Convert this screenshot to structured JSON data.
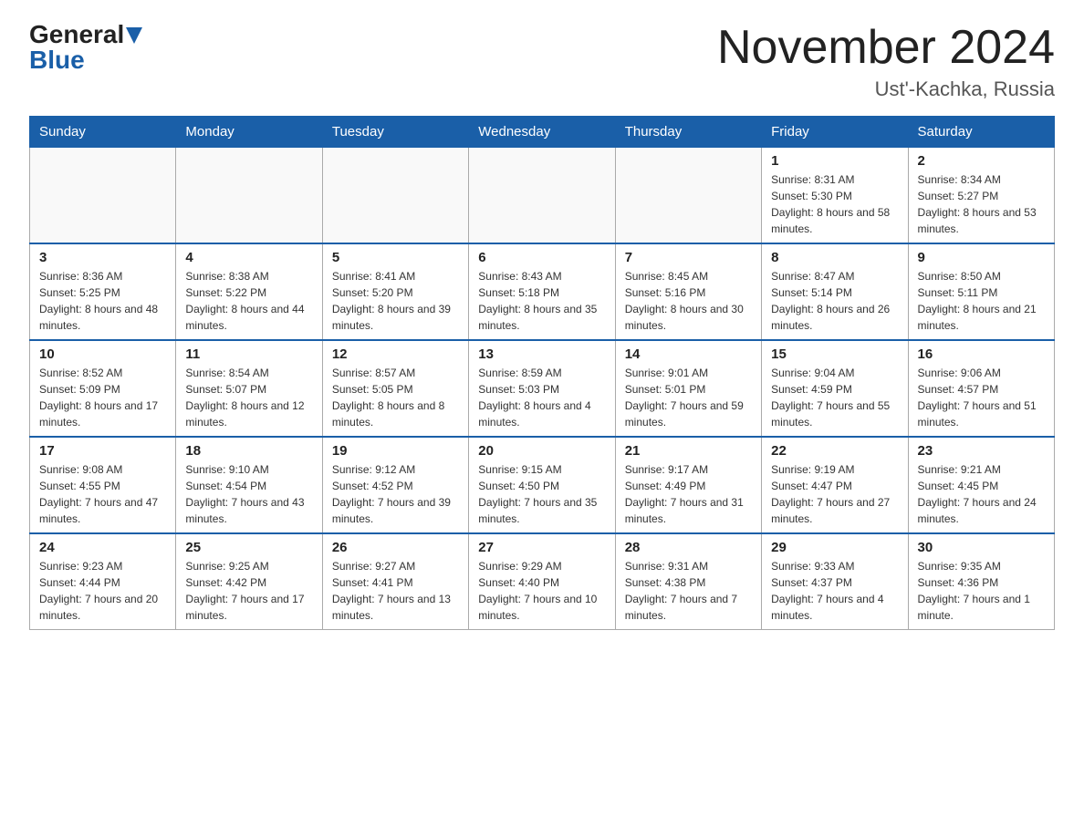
{
  "header": {
    "logo_general": "General",
    "logo_blue": "Blue",
    "month_title": "November 2024",
    "location": "Ust'-Kachka, Russia"
  },
  "days_of_week": [
    "Sunday",
    "Monday",
    "Tuesday",
    "Wednesday",
    "Thursday",
    "Friday",
    "Saturday"
  ],
  "weeks": [
    [
      {
        "day": "",
        "info": ""
      },
      {
        "day": "",
        "info": ""
      },
      {
        "day": "",
        "info": ""
      },
      {
        "day": "",
        "info": ""
      },
      {
        "day": "",
        "info": ""
      },
      {
        "day": "1",
        "info": "Sunrise: 8:31 AM\nSunset: 5:30 PM\nDaylight: 8 hours and 58 minutes."
      },
      {
        "day": "2",
        "info": "Sunrise: 8:34 AM\nSunset: 5:27 PM\nDaylight: 8 hours and 53 minutes."
      }
    ],
    [
      {
        "day": "3",
        "info": "Sunrise: 8:36 AM\nSunset: 5:25 PM\nDaylight: 8 hours and 48 minutes."
      },
      {
        "day": "4",
        "info": "Sunrise: 8:38 AM\nSunset: 5:22 PM\nDaylight: 8 hours and 44 minutes."
      },
      {
        "day": "5",
        "info": "Sunrise: 8:41 AM\nSunset: 5:20 PM\nDaylight: 8 hours and 39 minutes."
      },
      {
        "day": "6",
        "info": "Sunrise: 8:43 AM\nSunset: 5:18 PM\nDaylight: 8 hours and 35 minutes."
      },
      {
        "day": "7",
        "info": "Sunrise: 8:45 AM\nSunset: 5:16 PM\nDaylight: 8 hours and 30 minutes."
      },
      {
        "day": "8",
        "info": "Sunrise: 8:47 AM\nSunset: 5:14 PM\nDaylight: 8 hours and 26 minutes."
      },
      {
        "day": "9",
        "info": "Sunrise: 8:50 AM\nSunset: 5:11 PM\nDaylight: 8 hours and 21 minutes."
      }
    ],
    [
      {
        "day": "10",
        "info": "Sunrise: 8:52 AM\nSunset: 5:09 PM\nDaylight: 8 hours and 17 minutes."
      },
      {
        "day": "11",
        "info": "Sunrise: 8:54 AM\nSunset: 5:07 PM\nDaylight: 8 hours and 12 minutes."
      },
      {
        "day": "12",
        "info": "Sunrise: 8:57 AM\nSunset: 5:05 PM\nDaylight: 8 hours and 8 minutes."
      },
      {
        "day": "13",
        "info": "Sunrise: 8:59 AM\nSunset: 5:03 PM\nDaylight: 8 hours and 4 minutes."
      },
      {
        "day": "14",
        "info": "Sunrise: 9:01 AM\nSunset: 5:01 PM\nDaylight: 7 hours and 59 minutes."
      },
      {
        "day": "15",
        "info": "Sunrise: 9:04 AM\nSunset: 4:59 PM\nDaylight: 7 hours and 55 minutes."
      },
      {
        "day": "16",
        "info": "Sunrise: 9:06 AM\nSunset: 4:57 PM\nDaylight: 7 hours and 51 minutes."
      }
    ],
    [
      {
        "day": "17",
        "info": "Sunrise: 9:08 AM\nSunset: 4:55 PM\nDaylight: 7 hours and 47 minutes."
      },
      {
        "day": "18",
        "info": "Sunrise: 9:10 AM\nSunset: 4:54 PM\nDaylight: 7 hours and 43 minutes."
      },
      {
        "day": "19",
        "info": "Sunrise: 9:12 AM\nSunset: 4:52 PM\nDaylight: 7 hours and 39 minutes."
      },
      {
        "day": "20",
        "info": "Sunrise: 9:15 AM\nSunset: 4:50 PM\nDaylight: 7 hours and 35 minutes."
      },
      {
        "day": "21",
        "info": "Sunrise: 9:17 AM\nSunset: 4:49 PM\nDaylight: 7 hours and 31 minutes."
      },
      {
        "day": "22",
        "info": "Sunrise: 9:19 AM\nSunset: 4:47 PM\nDaylight: 7 hours and 27 minutes."
      },
      {
        "day": "23",
        "info": "Sunrise: 9:21 AM\nSunset: 4:45 PM\nDaylight: 7 hours and 24 minutes."
      }
    ],
    [
      {
        "day": "24",
        "info": "Sunrise: 9:23 AM\nSunset: 4:44 PM\nDaylight: 7 hours and 20 minutes."
      },
      {
        "day": "25",
        "info": "Sunrise: 9:25 AM\nSunset: 4:42 PM\nDaylight: 7 hours and 17 minutes."
      },
      {
        "day": "26",
        "info": "Sunrise: 9:27 AM\nSunset: 4:41 PM\nDaylight: 7 hours and 13 minutes."
      },
      {
        "day": "27",
        "info": "Sunrise: 9:29 AM\nSunset: 4:40 PM\nDaylight: 7 hours and 10 minutes."
      },
      {
        "day": "28",
        "info": "Sunrise: 9:31 AM\nSunset: 4:38 PM\nDaylight: 7 hours and 7 minutes."
      },
      {
        "day": "29",
        "info": "Sunrise: 9:33 AM\nSunset: 4:37 PM\nDaylight: 7 hours and 4 minutes."
      },
      {
        "day": "30",
        "info": "Sunrise: 9:35 AM\nSunset: 4:36 PM\nDaylight: 7 hours and 1 minute."
      }
    ]
  ]
}
